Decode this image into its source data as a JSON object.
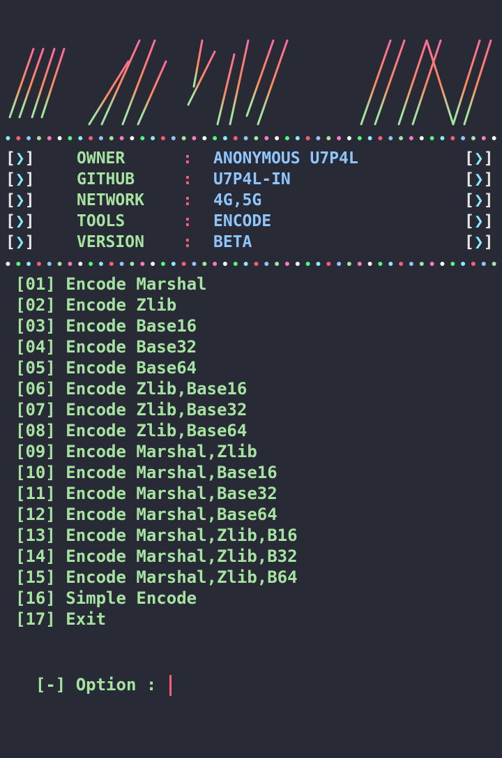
{
  "banner": {
    "text": "U7P4L IN",
    "colors": [
      "#ff6b9a",
      "#ff8a5c",
      "#a6e3a1"
    ]
  },
  "dot_colors": [
    "#8be9fd",
    "#f8f8f2",
    "#a6e3a1",
    "#ff5c7a",
    "#50fa7b",
    "#ff79c6",
    "#8fc5ff"
  ],
  "info_bracket_label": "[❯]",
  "info_separator": ":",
  "info": [
    {
      "key": "OWNER",
      "value": "ANONYMOUS U7P4L"
    },
    {
      "key": "GITHUB",
      "value": "U7P4L-IN"
    },
    {
      "key": "NETWORK",
      "value": "4G,5G"
    },
    {
      "key": "TOOLS",
      "value": "ENCODE"
    },
    {
      "key": "VERSION",
      "value": "BETA"
    }
  ],
  "menu": [
    "[01] Encode Marshal",
    "[02] Encode Zlib",
    "[03] Encode Base16",
    "[04] Encode Base32",
    "[05] Encode Base64",
    "[06] Encode Zlib,Base16",
    "[07] Encode Zlib,Base32",
    "[08] Encode Zlib,Base64",
    "[09] Encode Marshal,Zlib",
    "[10] Encode Marshal,Base16",
    "[11] Encode Marshal,Base32",
    "[12] Encode Marshal,Base64",
    "[13] Encode Marshal,Zlib,B16",
    "[14] Encode Marshal,Zlib,B32",
    "[15] Encode Marshal,Zlib,B64",
    "[16] Simple Encode",
    "[17] Exit"
  ],
  "prompt": {
    "label": "[-] Option : ",
    "value": ""
  },
  "colors": {
    "background": "#282a36",
    "text_green": "#a6e3a1",
    "value_blue": "#8fc5ff",
    "separator_red": "#ff5c7a"
  }
}
